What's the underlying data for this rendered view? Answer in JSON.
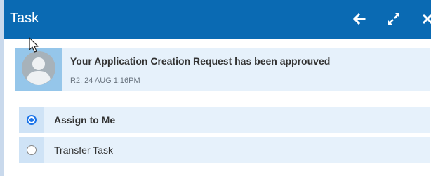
{
  "header": {
    "title": "Task",
    "actions": [
      {
        "name": "back",
        "icon": "arrow-left-icon"
      },
      {
        "name": "expand",
        "icon": "expand-icon"
      },
      {
        "name": "close",
        "icon": "close-icon"
      }
    ]
  },
  "notification": {
    "title": "Your Application Creation Request has been approuved",
    "meta": "R2, 24 AUG 1:16PM",
    "avatar_icon": "user-avatar-icon"
  },
  "options": [
    {
      "label": "Assign to Me",
      "selected": true
    },
    {
      "label": "Transfer Task",
      "selected": false
    }
  ],
  "colors": {
    "header_bg": "#0a6ab3",
    "row_bg": "#e6f1fb",
    "radio_cell_bg": "#cfe3f6",
    "avatar_bg": "#95c6ea",
    "radio_accent": "#1a73e8"
  }
}
